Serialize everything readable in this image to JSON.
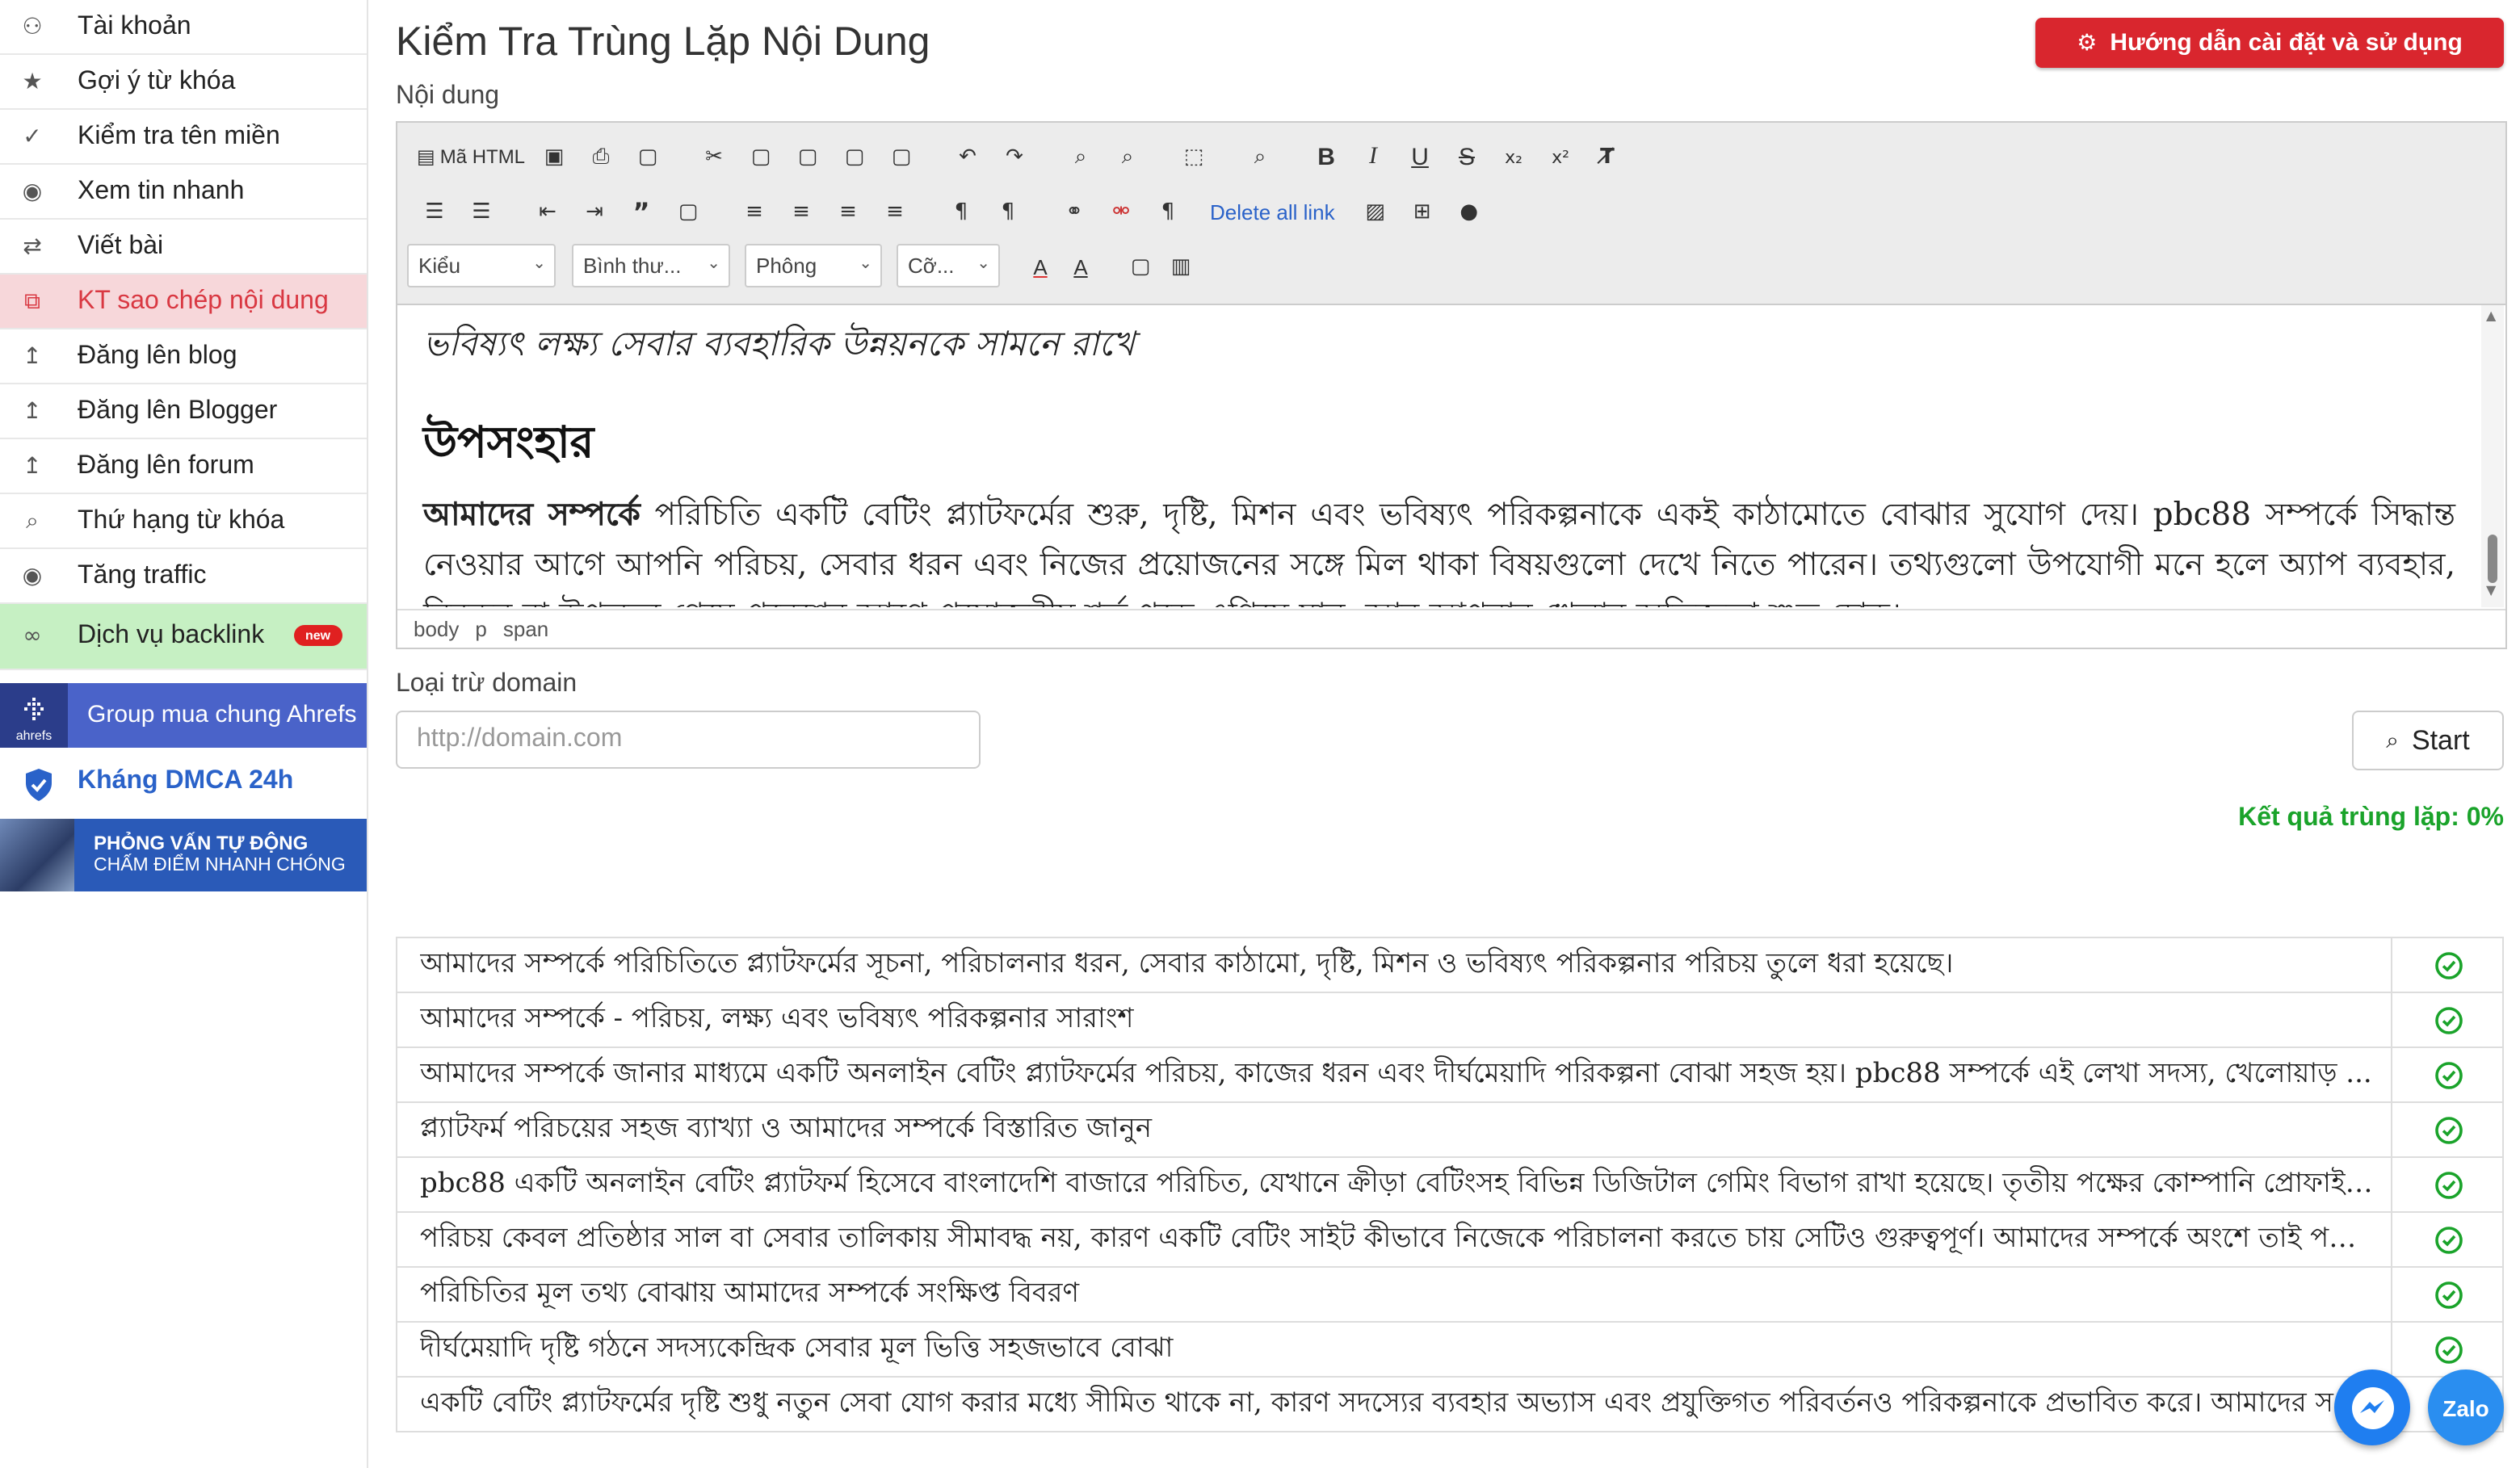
{
  "sidebar": {
    "items": [
      {
        "label": "Tài khoản",
        "icon": "user-icon",
        "glyph": "⚇"
      },
      {
        "label": "Gợi ý từ khóa",
        "icon": "star-icon",
        "glyph": "★"
      },
      {
        "label": "Kiểm tra tên miền",
        "icon": "check-icon",
        "glyph": "✓"
      },
      {
        "label": "Xem tin nhanh",
        "icon": "eye-icon",
        "glyph": "◉"
      },
      {
        "label": "Viết bài",
        "icon": "swap-icon",
        "glyph": "⇄"
      },
      {
        "label": "KT sao chép nội dung",
        "icon": "copy-icon",
        "glyph": "⧉"
      },
      {
        "label": "Đăng lên blog",
        "icon": "upload-icon",
        "glyph": "↥"
      },
      {
        "label": "Đăng lên Blogger",
        "icon": "upload-icon",
        "glyph": "↥"
      },
      {
        "label": "Đăng lên forum",
        "icon": "upload-icon",
        "glyph": "↥"
      },
      {
        "label": "Thứ hạng từ khóa",
        "icon": "search-icon",
        "glyph": "⌕"
      },
      {
        "label": "Tăng traffic",
        "icon": "eye-icon",
        "glyph": "◉"
      },
      {
        "label": "Dịch vụ backlink",
        "icon": "link-icon",
        "glyph": "∞",
        "badge": "new"
      }
    ],
    "ahrefs": {
      "logo_text": "ahrefs",
      "label": "Group mua chung Ahrefs"
    },
    "dmca": {
      "label": "Kháng DMCA 24h"
    },
    "interview": {
      "line1": "PHỎNG VẤN TỰ ĐỘNG",
      "line2": "CHẤM ĐIỂM NHANH CHÓNG"
    }
  },
  "header": {
    "title": "Kiểm Tra Trùng Lặp Nội Dung",
    "guide_button": "Hướng dẫn cài đặt và sử dụng"
  },
  "editor": {
    "label": "Nội dung",
    "source_button": "Mã HTML",
    "delete_links": "Delete all link",
    "dropdowns": {
      "style": "Kiểu",
      "format": "Bình thư...",
      "font": "Phông",
      "size": "Cỡ..."
    },
    "body": {
      "italic_line": "ভবিষ্যৎ লক্ষ্য সেবার ব্যবহারিক উন্নয়নকে সামনে রাখে",
      "heading": "উপসংহার",
      "para_bold": "আমাদের সম্পর্কে",
      "para_rest": " পরিচিতি একটি বেটিং প্ল্যাটফর্মের শুরু, দৃষ্টি, মিশন এবং ভবিষ্যৎ পরিকল্পনাকে একই কাঠামোতে বোঝার সুযোগ দেয়। pbc88 সম্পর্কে সিদ্ধান্ত নেওয়ার আগে আপনি পরিচয়, সেবার ধরন এবং নিজের প্রয়োজনের সঙ্গে মিল থাকা বিষয়গুলো দেখে নিতে পারেন। তথ্যগুলো উপযোগী মনে হলে অ্যাপ ব্যবহার, নিবন্ধন বা উপলভ্য গেমে প্রবেশের আগে প্রয়োজনীয় শর্ত পড়ে এগিয়ে যান, আর আপনার খেলার অভিজ্ঞতা শুভ হোক।"
    },
    "path": [
      "body",
      "p",
      "span"
    ]
  },
  "exclude": {
    "label": "Loại trừ domain",
    "placeholder": "http://domain.com"
  },
  "start_button": "Start",
  "result_text": "Kết quả trùng lặp: 0%",
  "results": [
    "আমাদের সম্পর্কে পরিচিতিতে প্ল্যাটফর্মের সূচনা, পরিচালনার ধরন, সেবার কাঠামো, দৃষ্টি, মিশন ও ভবিষ্যৎ পরিকল্পনার পরিচয় তুলে ধরা হয়েছে।",
    "আমাদের সম্পর্কে - পরিচয়, লক্ষ্য এবং ভবিষ্যৎ পরিকল্পনার সারাংশ",
    "আমাদের সম্পর্কে জানার মাধ্যমে একটি অনলাইন বেটিং প্ল্যাটফর্মের পরিচয়, কাজের ধরন এবং দীর্ঘমেয়াদি পরিকল্পনা বোঝা সহজ হয়। pbc88 সম্পর্কে এই লেখা সদস্য, খেলোয়াড় ...",
    "প্ল্যাটফর্ম পরিচয়ের সহজ ব্যাখ্যা ও আমাদের সম্পর্কে বিস্তারিত জানুন",
    "pbc88 একটি অনলাইন বেটিং প্ল্যাটফর্ম হিসেবে বাংলাদেশি বাজারে পরিচিত, যেখানে ক্রীড়া বেটিংসহ বিভিন্ন ডিজিটাল গেমিং বিভাগ রাখা হয়েছে। তৃতীয় পক্ষের কোম্পানি প্রোফাইল ...",
    "পরিচয় কেবল প্রতিষ্ঠার সাল বা সেবার তালিকায় সীমাবদ্ধ নয়, কারণ একটি বেটিং সাইট কীভাবে নিজেকে পরিচালনা করতে চায় সেটিও গুরুত্বপূর্ণ। আমাদের সম্পর্কে অংশে তাই পরি...",
    "পরিচিতির মূল তথ্য বোঝায় আমাদের সম্পর্কে সংক্ষিপ্ত বিবরণ",
    "দীর্ঘমেয়াদি দৃষ্টি গঠনে সদস্যকেন্দ্রিক সেবার মূল ভিত্তি সহজভাবে বোঝা",
    "একটি বেটিং প্ল্যাটফর্মের দৃষ্টি শুধু নতুন সেবা যোগ করার মধ্যে সীমিত থাকে না, কারণ সদস্যের ব্যবহার অভ্যাস এবং প্রযুক্তিগত পরিবর্তনও পরিকল্পনাকে প্রভাবিত করে। আমাদের স"
  ],
  "fabs": {
    "zalo": "Zalo"
  },
  "colors": {
    "accent_red": "#d9262e",
    "active_bg": "#f7d7da",
    "green_text": "#1aa32a",
    "blue": "#2a62c9"
  }
}
